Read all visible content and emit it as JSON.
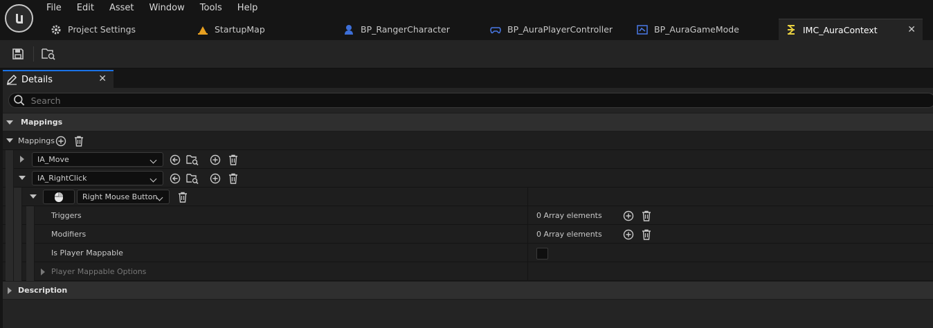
{
  "menu": [
    "File",
    "Edit",
    "Asset",
    "Window",
    "Tools",
    "Help"
  ],
  "tabs": [
    {
      "label": "Project Settings",
      "icon": "gear-icon"
    },
    {
      "label": "StartupMap",
      "icon": "level-icon"
    },
    {
      "label": "BP_RangerCharacter",
      "icon": "character-icon"
    },
    {
      "label": "BP_AuraPlayerController",
      "icon": "gamepad-icon"
    },
    {
      "label": "BP_AuraGameMode",
      "icon": "gamemode-icon"
    },
    {
      "label": "IMC_AuraContext",
      "icon": "input-context-icon",
      "active": true
    }
  ],
  "toolbar": {
    "save_icon": "save-icon",
    "browse_icon": "browse-asset-icon"
  },
  "details": {
    "tab_label": "Details",
    "search_placeholder": "Search",
    "category_mappings": "Mappings",
    "mappings_label": "Mappings",
    "mapping_1": {
      "action": "IA_Move"
    },
    "mapping_2": {
      "action": "IA_RightClick",
      "key": "Right Mouse Button"
    },
    "triggers": {
      "label": "Triggers",
      "value": "0 Array elements"
    },
    "modifiers": {
      "label": "Modifiers",
      "value": "0 Array elements"
    },
    "is_player_mappable": {
      "label": "Is Player Mappable",
      "checked": false
    },
    "player_mappable_options": {
      "label": "Player Mappable Options"
    },
    "category_description": "Description"
  },
  "colors": {
    "accent": "#1a73e8",
    "background": "#151515",
    "panel": "#242424"
  }
}
